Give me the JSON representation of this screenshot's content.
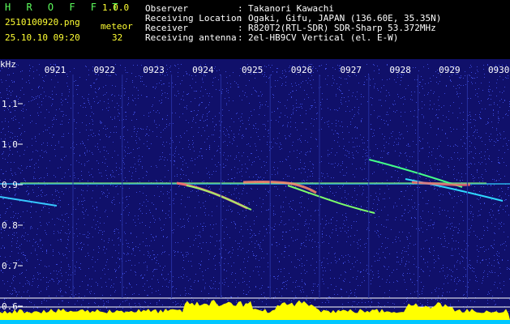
{
  "header": {
    "app_title": "H R O F F T",
    "version": "1.0.0",
    "filename": "2510100920.png",
    "datetime": "25.10.10 09:20",
    "meteor_label": "meteor",
    "meteor_count": "32",
    "info": [
      {
        "label": "Observer",
        "sep": ":",
        "value": "Takanori Kawachi"
      },
      {
        "label": "Receiving Location",
        "sep": ":",
        "value": "Ogaki, Gifu, JAPAN (136.60E, 35.35N)"
      },
      {
        "label": "Receiver",
        "sep": ":",
        "value": "R820T2(RTL-SDR) SDR-Sharp 53.372MHz"
      },
      {
        "label": "Receiving antenna",
        "sep": ":",
        "value": "2el-HB9CV Vertical (el. E-W)"
      }
    ]
  },
  "spectrogram": {
    "unit_label": "kHz",
    "time_ticks": [
      "0921",
      "0922",
      "0923",
      "0924",
      "0925",
      "0926",
      "0927",
      "0928",
      "0929",
      "0930"
    ],
    "freq_ticks": [
      "1.1",
      "1.0",
      "0.9",
      "0.8",
      "0.7",
      "0.6"
    ],
    "colors": {
      "background": "#10106a",
      "noise": "#3a48d8",
      "text": "#ffffff",
      "level_bar": "#ffff00",
      "level_base": "#00c8ff"
    }
  }
}
